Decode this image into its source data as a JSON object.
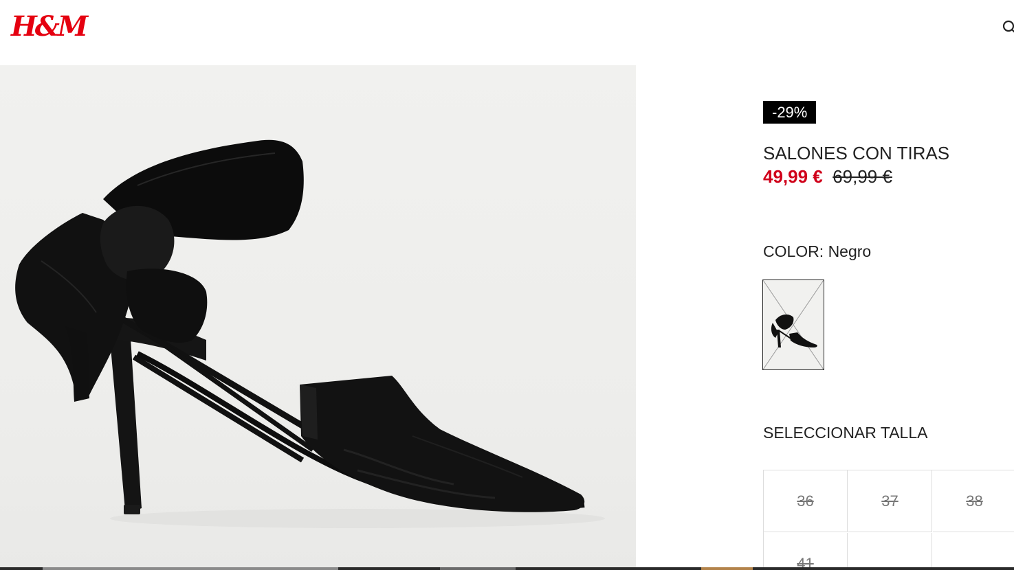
{
  "header": {
    "logo_text": "H&M",
    "search_icon": "search-icon"
  },
  "product": {
    "discount_badge": "-29%",
    "title": "SALONES CON TIRAS",
    "price_sale": "49,99 €",
    "price_original": "69,99 €",
    "color_label": "COLOR: Negro",
    "color_swatch_icon": "shoe-thumbnail",
    "size_label": "SELECCIONAR TALLA",
    "sizes": [
      "36",
      "37",
      "38",
      "41"
    ],
    "sizes_unavailable": true
  },
  "colors": {
    "brand": "#e50010",
    "sale_price": "#d0011b",
    "badge_bg": "#000000"
  }
}
